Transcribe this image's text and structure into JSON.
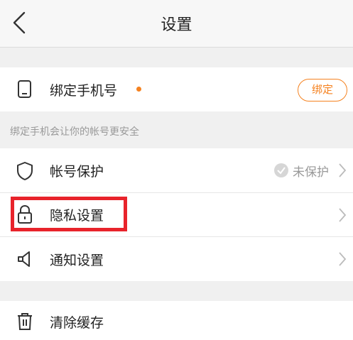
{
  "header": {
    "title": "设置"
  },
  "bind_phone": {
    "label": "绑定手机号",
    "button_label": "绑定",
    "hint": "绑定手机会让你的帐号更安全"
  },
  "menu": {
    "account_protection": {
      "label": "帐号保护",
      "status": "未保护"
    },
    "privacy": {
      "label": "隐私设置"
    },
    "notifications": {
      "label": "通知设置"
    }
  },
  "clear_cache": {
    "label": "清除缓存"
  },
  "colors": {
    "accent": "#f58220",
    "highlight": "#e8232b"
  },
  "icons": [
    "back-arrow-icon",
    "phone-icon",
    "shield-icon",
    "lock-icon",
    "megaphone-icon",
    "trash-icon",
    "chevron-right-icon",
    "check-circle-icon"
  ]
}
